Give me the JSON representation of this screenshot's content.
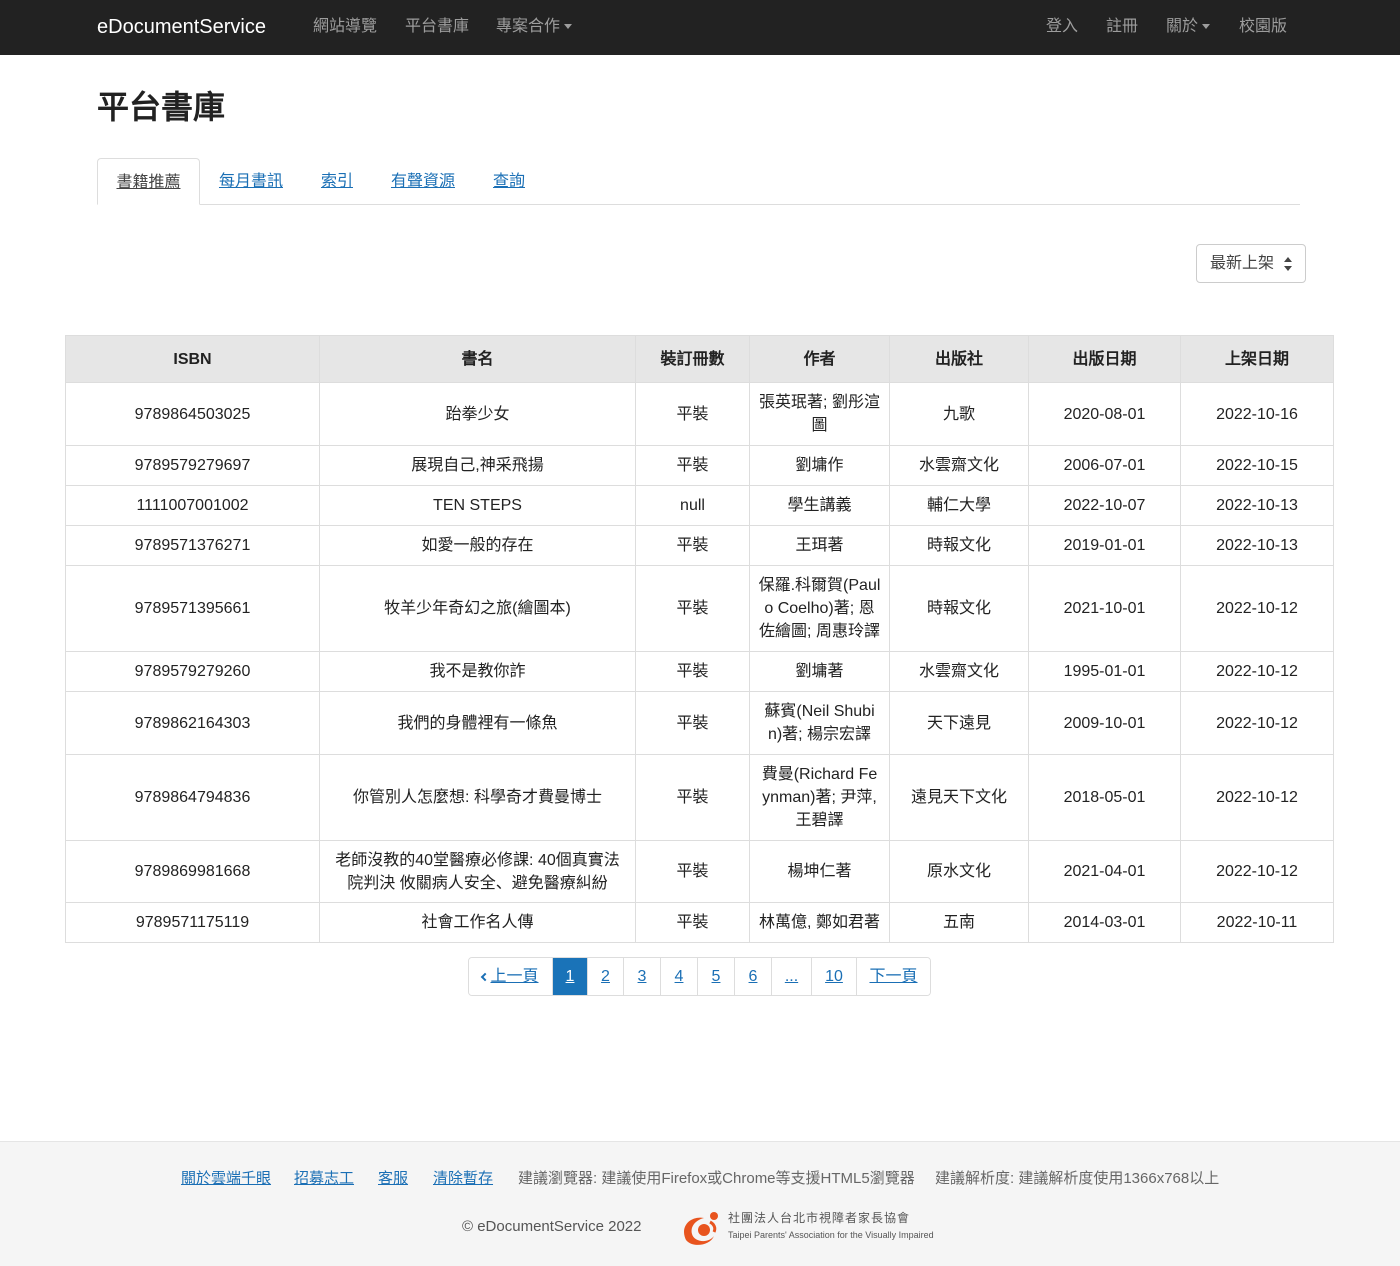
{
  "navbar": {
    "brand": "eDocumentService",
    "left_items": [
      "網站導覽",
      "平台書庫",
      "專案合作"
    ],
    "right_items": [
      "登入",
      "註冊",
      "關於",
      "校園版"
    ]
  },
  "page_title": "平台書庫",
  "tabs": [
    "書籍推薦",
    "每月書訊",
    "索引",
    "有聲資源",
    "查詢"
  ],
  "sort": {
    "selected": "最新上架"
  },
  "table": {
    "headers": [
      "ISBN",
      "書名",
      "裝訂冊數",
      "作者",
      "出版社",
      "出版日期",
      "上架日期"
    ],
    "rows": [
      [
        "9789864503025",
        "跆拳少女",
        "平裝",
        "張英珉著; 劉彤渲圖",
        "九歌",
        "2020-08-01",
        "2022-10-16"
      ],
      [
        "9789579279697",
        "展現自己,神采飛揚",
        "平裝",
        "劉墉作",
        "水雲齋文化",
        "2006-07-01",
        "2022-10-15"
      ],
      [
        "1111007001002",
        "TEN STEPS",
        "null",
        "學生講義",
        "輔仁大學",
        "2022-10-07",
        "2022-10-13"
      ],
      [
        "9789571376271",
        "如愛一般的存在",
        "平裝",
        "王珥著",
        "時報文化",
        "2019-01-01",
        "2022-10-13"
      ],
      [
        "9789571395661",
        "牧羊少年奇幻之旅(繪圖本)",
        "平裝",
        "保羅.科爾賀(Paulo Coelho)著; 恩佐繪圖; 周惠玲譯",
        "時報文化",
        "2021-10-01",
        "2022-10-12"
      ],
      [
        "9789579279260",
        "我不是教你詐",
        "平裝",
        "劉墉著",
        "水雲齋文化",
        "1995-01-01",
        "2022-10-12"
      ],
      [
        "9789862164303",
        "我們的身體裡有一條魚",
        "平裝",
        "蘇賓(Neil Shubin)著; 楊宗宏譯",
        "天下遠見",
        "2009-10-01",
        "2022-10-12"
      ],
      [
        "9789864794836",
        "你管別人怎麼想: 科學奇才費曼博士",
        "平裝",
        "費曼(Richard Feynman)著; 尹萍, 王碧譯",
        "遠見天下文化",
        "2018-05-01",
        "2022-10-12"
      ],
      [
        "9789869981668",
        "老師沒教的40堂醫療必修課: 40個真實法院判決 攸關病人安全、避免醫療糾紛",
        "平裝",
        "楊坤仁著",
        "原水文化",
        "2021-04-01",
        "2022-10-12"
      ],
      [
        "9789571175119",
        "社會工作名人傳",
        "平裝",
        "林萬億, 鄭如君著",
        "五南",
        "2014-03-01",
        "2022-10-11"
      ]
    ]
  },
  "pagination": {
    "prev": "上一頁",
    "pages": [
      "1",
      "2",
      "3",
      "4",
      "5",
      "6",
      "...",
      "10"
    ],
    "current": "1",
    "next": "下一頁"
  },
  "footer": {
    "links": [
      "關於雲端千眼",
      "招募志工",
      "客服",
      "清除暫存"
    ],
    "browser_note": "建議瀏覽器: 建議使用Firefox或Chrome等支援HTML5瀏覽器",
    "resolution_note": "建議解析度: 建議解析度使用1366x768以上",
    "copyright": "© eDocumentService 2022",
    "logo_line1": "社團法人台北市視障者家長協會",
    "logo_line2": "Taipei Parents' Association for the Visually Impaired"
  },
  "colors": {
    "navbar_bg": "#222222",
    "link": "#1a6fb5",
    "active_page": "#1a73b8",
    "header_bg": "#e6e6e6",
    "logo_orange": "#e8541e"
  }
}
